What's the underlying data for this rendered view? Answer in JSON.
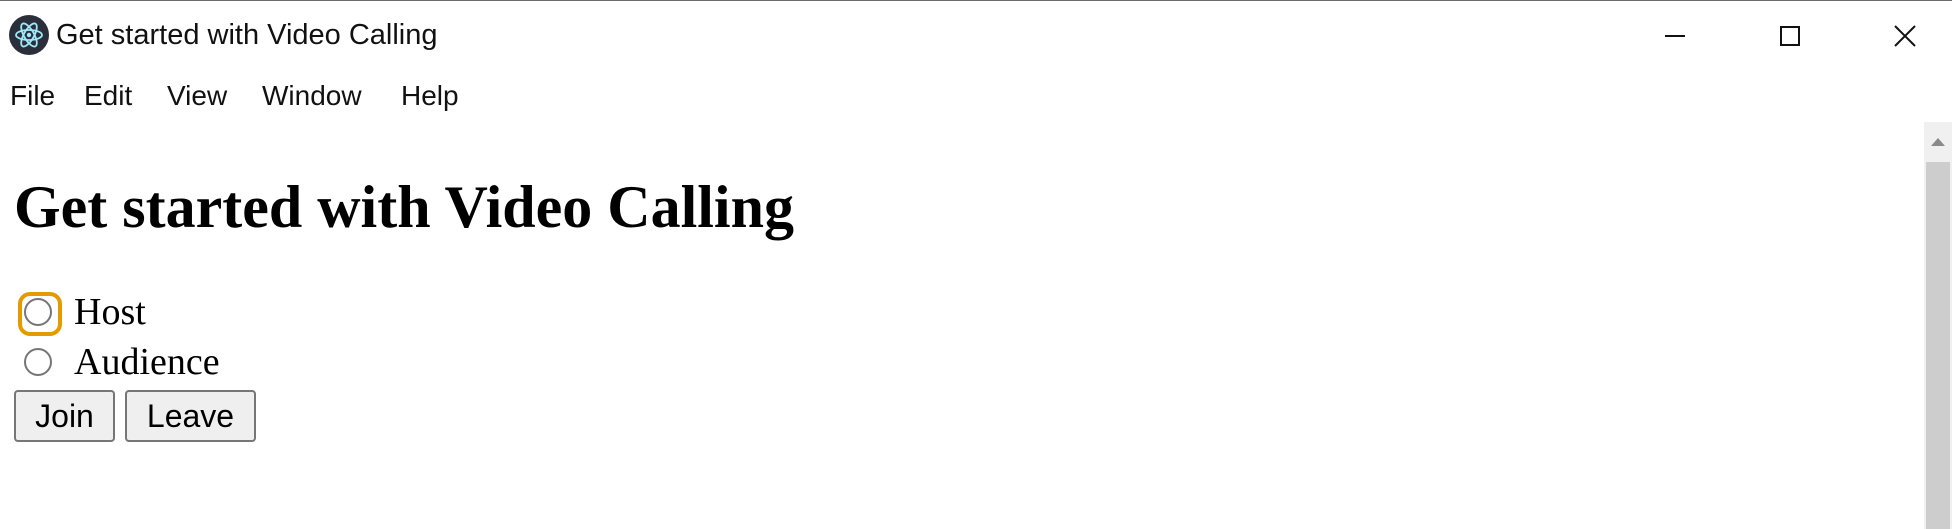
{
  "window": {
    "title": "Get started with Video Calling",
    "controls": {
      "minimize": "minimize-icon",
      "maximize": "maximize-icon",
      "close": "close-icon"
    }
  },
  "menu": [
    "File",
    "Edit",
    "View",
    "Window",
    "Help"
  ],
  "main": {
    "heading": "Get started with Video Calling",
    "roles": [
      {
        "label": "Host",
        "checked": false,
        "focused": true
      },
      {
        "label": "Audience",
        "checked": false,
        "focused": false
      }
    ],
    "buttons": {
      "join": "Join",
      "leave": "Leave"
    }
  },
  "colors": {
    "focus_ring": "#e59b00",
    "app_icon_bg": "#2b2e3b",
    "app_icon_fg": "#9feaf9"
  }
}
